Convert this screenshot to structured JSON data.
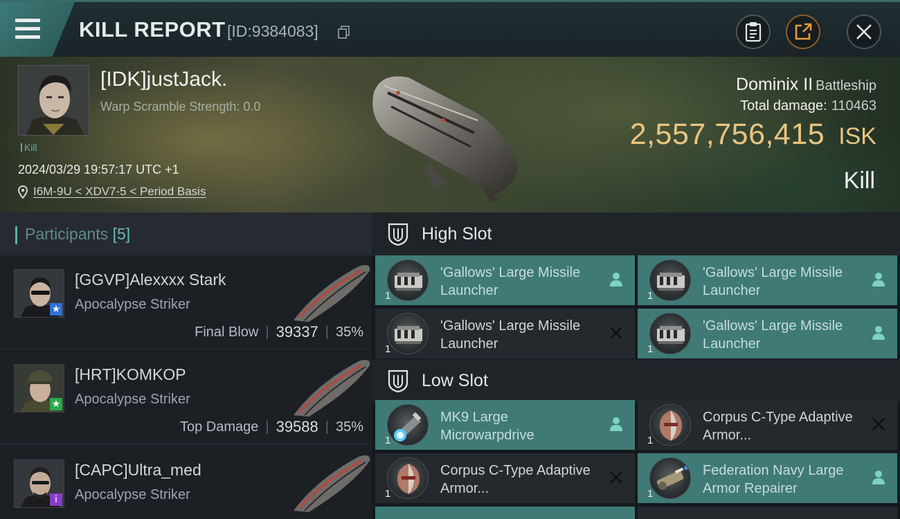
{
  "header": {
    "title": "KILL REPORT",
    "kill_id": "[ID:9384083]",
    "buttons": [
      "clipboard-icon",
      "share-icon",
      "close-icon"
    ]
  },
  "victim": {
    "name": "[IDK]justJack.",
    "warp_scramble": "Warp Scramble Strength: 0.0",
    "tag": "Kill",
    "datetime": "2024/03/29 19:57:17 UTC +1",
    "location": "I6M-9U < XDV7-5 < Period Basis",
    "ship_name": "Dominix II",
    "ship_class": "Battleship",
    "total_damage_label": "Total damage:",
    "total_damage": "110463",
    "isk_value": "2,557,756,415",
    "isk_unit": "ISK",
    "result": "Kill"
  },
  "participants": {
    "label": "Participants",
    "count": "[5]",
    "items": [
      {
        "name": "[GGVP]Alexxxx Stark",
        "ship": "Apocalypse Striker",
        "role": "Final Blow",
        "damage": "39337",
        "percent": "35%",
        "badge": "★",
        "badge_color": "#2f6fd6"
      },
      {
        "name": "[HRT]KOMKOP",
        "ship": "Apocalypse Striker",
        "role": "Top Damage",
        "damage": "39588",
        "percent": "35%",
        "badge": "★",
        "badge_color": "#2aa84a"
      },
      {
        "name": "[CAPC]Ultra_med",
        "ship": "Apocalypse Striker",
        "role": "",
        "damage": "",
        "percent": "",
        "badge": "i",
        "badge_color": "#8a3cc8"
      }
    ]
  },
  "slots": {
    "high": {
      "label": "High Slot",
      "modules": [
        {
          "name": "'Gallows' Large Missile Launcher",
          "qty": "1",
          "state": "dropped"
        },
        {
          "name": "'Gallows' Large Missile Launcher",
          "qty": "1",
          "state": "dropped"
        },
        {
          "name": "'Gallows' Large Missile Launcher",
          "qty": "1",
          "state": "destroyed"
        },
        {
          "name": "'Gallows' Large Missile Launcher",
          "qty": "1",
          "state": "dropped"
        }
      ]
    },
    "low": {
      "label": "Low Slot",
      "modules": [
        {
          "name": "MK9 Large Microwarpdrive",
          "qty": "1",
          "state": "dropped"
        },
        {
          "name": "Corpus C-Type Adaptive Armor...",
          "qty": "1",
          "state": "destroyed"
        },
        {
          "name": "Corpus C-Type Adaptive Armor...",
          "qty": "1",
          "state": "destroyed"
        },
        {
          "name": "Federation Navy Large Armor Repairer",
          "qty": "1",
          "state": "dropped"
        }
      ]
    }
  },
  "colors": {
    "accent_teal": "#3f7a76",
    "isk_gold": "#e8c583"
  }
}
